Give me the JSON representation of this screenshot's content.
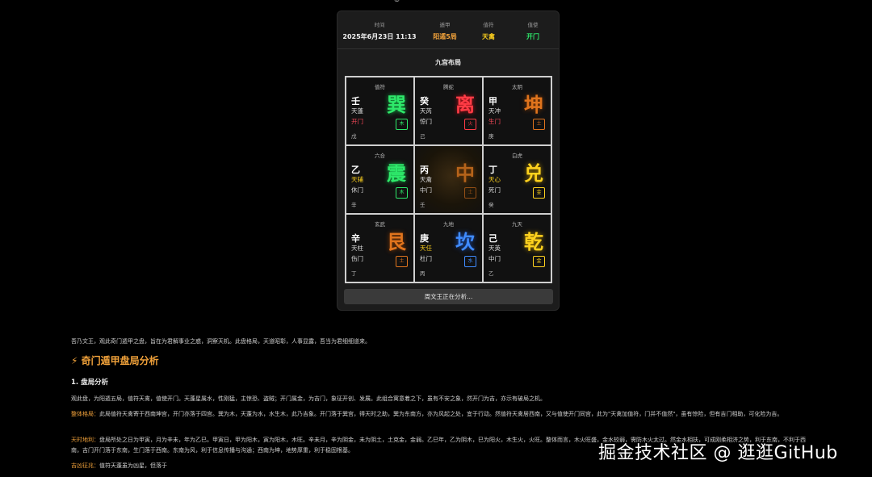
{
  "top_strip": "◎",
  "meta": {
    "time_label": "时间",
    "time_value": "2025年6月23日 11:13",
    "ju_label": "遁甲",
    "ju_value": "阳遁5局",
    "zhifu_label": "值符",
    "zhifu_value": "天禽",
    "zhishi_label": "值使",
    "zhishi_value": "开门"
  },
  "layout_title": "九宫布局",
  "cells": [
    {
      "god": "值符",
      "stem": "壬",
      "star": "天蓬",
      "door": "开门",
      "earth": "戊",
      "gua": "巽",
      "elem": "木"
    },
    {
      "god": "腾蛇",
      "stem": "癸",
      "star": "天芮",
      "door": "惊门",
      "earth": "己",
      "gua": "离",
      "elem": "火"
    },
    {
      "god": "太阴",
      "stem": "甲",
      "star": "天冲",
      "door": "生门",
      "earth": "庚",
      "gua": "坤",
      "elem": "土"
    },
    {
      "god": "六合",
      "stem": "乙",
      "star": "天辅",
      "door": "休门",
      "earth": "辛",
      "gua": "震",
      "elem": "木"
    },
    {
      "god": "",
      "stem": "丙",
      "star": "天禽",
      "door": "中门",
      "earth": "壬",
      "gua": "中",
      "elem": "土"
    },
    {
      "god": "白虎",
      "stem": "丁",
      "star": "天心",
      "door": "死门",
      "earth": "癸",
      "gua": "兑",
      "elem": "金"
    },
    {
      "god": "玄武",
      "stem": "辛",
      "star": "天柱",
      "door": "伤门",
      "earth": "丁",
      "gua": "艮",
      "elem": "土"
    },
    {
      "god": "九地",
      "stem": "庚",
      "star": "天任",
      "door": "杜门",
      "earth": "丙",
      "gua": "坎",
      "elem": "水"
    },
    {
      "god": "九天",
      "stem": "己",
      "star": "天英",
      "door": "中门",
      "earth": "乙",
      "gua": "乾",
      "elem": "金"
    }
  ],
  "analyze_button": "周文王正在分析...",
  "intro": "吾乃文王，观此奇门遁甲之盘，旨在为君解事业之惑，洞察天机。此盘格局，天道昭彰，人事显露，吾当为君细细道来。",
  "analysis_heading": "奇门遁甲盘局分析",
  "sub_heading": "1. 盘局分析",
  "paragraphs": [
    {
      "label": "",
      "text": "观此盘，为阳遁五局，值符天禽，值使开门。天蓬星属水，性刚猛，主惊恐、盗贼；开门属金，为吉门，象征开创、发展。此组合寓意着之下，虽有不安之象，然开门为吉，亦示有破局之机。"
    },
    {
      "label": "整体格局：",
      "text": "此局值符天禽寄于西南坤宫，开门亦落于四宫。巽为木，天蓬为水，水生木，此乃吉象。开门落于巽宫，得天时之助，巽为东南方，亦为风起之处，宜于行动。然值符天禽居西南，又与值使开门同宫，此为\"天禽加值符，门并不值然\"，虽有惊险，但有吉门相助，可化险为吉。"
    },
    {
      "label": "天时地利：",
      "text": "盘局所处之日为甲寅，月为辛未，年为乙巳。甲寅日，甲为阳木，寅为阳木，木旺。辛未月，辛为阴金，未为阴土，土克金，金弱。乙巳年，乙为阴木，巳为阳火，木生火，火旺。整体而言，木火旺盛，金水较弱，需防木火太过。然金水相扶，可成刚柔相济之势，利于东南，不利于西南，吉门开门落于东南，生门落于西南。东南为风，利于信息传播与沟通；西南为坤，地势厚重，利于稳固根基。"
    },
    {
      "label": "吉凶征兆：",
      "text": "值符天蓬虽为凶星，但落于"
    }
  ],
  "watermark": "掘金技术社区 @ 逛逛GitHub"
}
